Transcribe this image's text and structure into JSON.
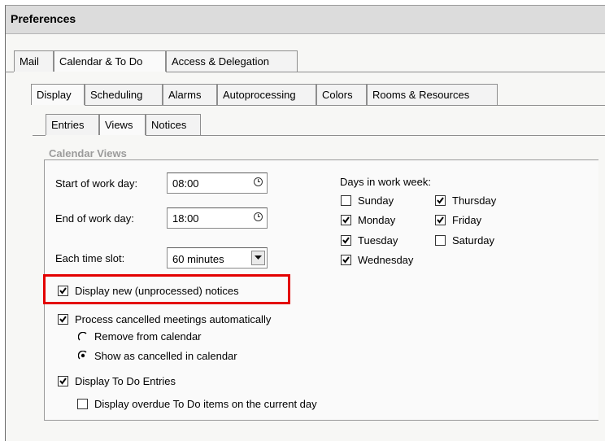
{
  "window": {
    "title": "Preferences"
  },
  "tabs_level1": [
    "Mail",
    "Calendar & To Do",
    "Access & Delegation"
  ],
  "tabs_level2": [
    "Display",
    "Scheduling",
    "Alarms",
    "Autoprocessing",
    "Colors",
    "Rooms & Resources"
  ],
  "tabs_level3": [
    "Entries",
    "Views",
    "Notices"
  ],
  "section": {
    "title": "Calendar Views"
  },
  "fields": {
    "start_label": "Start of work day:",
    "start_value": "08:00",
    "end_label": "End of work day:",
    "end_value": "18:00",
    "slot_label": "Each time slot:",
    "slot_value": "60 minutes"
  },
  "workweek": {
    "label": "Days in work week:",
    "days": [
      {
        "label": "Sunday",
        "checked": false
      },
      {
        "label": "Monday",
        "checked": true
      },
      {
        "label": "Tuesday",
        "checked": true
      },
      {
        "label": "Wednesday",
        "checked": true
      },
      {
        "label": "Thursday",
        "checked": true
      },
      {
        "label": "Friday",
        "checked": true
      },
      {
        "label": "Saturday",
        "checked": false
      }
    ]
  },
  "options": {
    "display_new": {
      "label": "Display new (unprocessed) notices",
      "checked": true
    },
    "process_cancelled": {
      "label": "Process cancelled meetings automatically",
      "checked": true
    },
    "remove": {
      "label": "Remove from calendar",
      "selected": false
    },
    "show_cancelled": {
      "label": "Show as cancelled in calendar",
      "selected": true
    },
    "display_todo": {
      "label": "Display To Do Entries",
      "checked": true
    },
    "display_overdue": {
      "label": "Display overdue To Do items on the current day",
      "checked": false
    }
  },
  "colors": {
    "highlight": "#e30000",
    "section_title": "#9b9b9b"
  },
  "icons": {
    "clock": "clock-icon",
    "dropdown": "chevron-down-icon"
  }
}
